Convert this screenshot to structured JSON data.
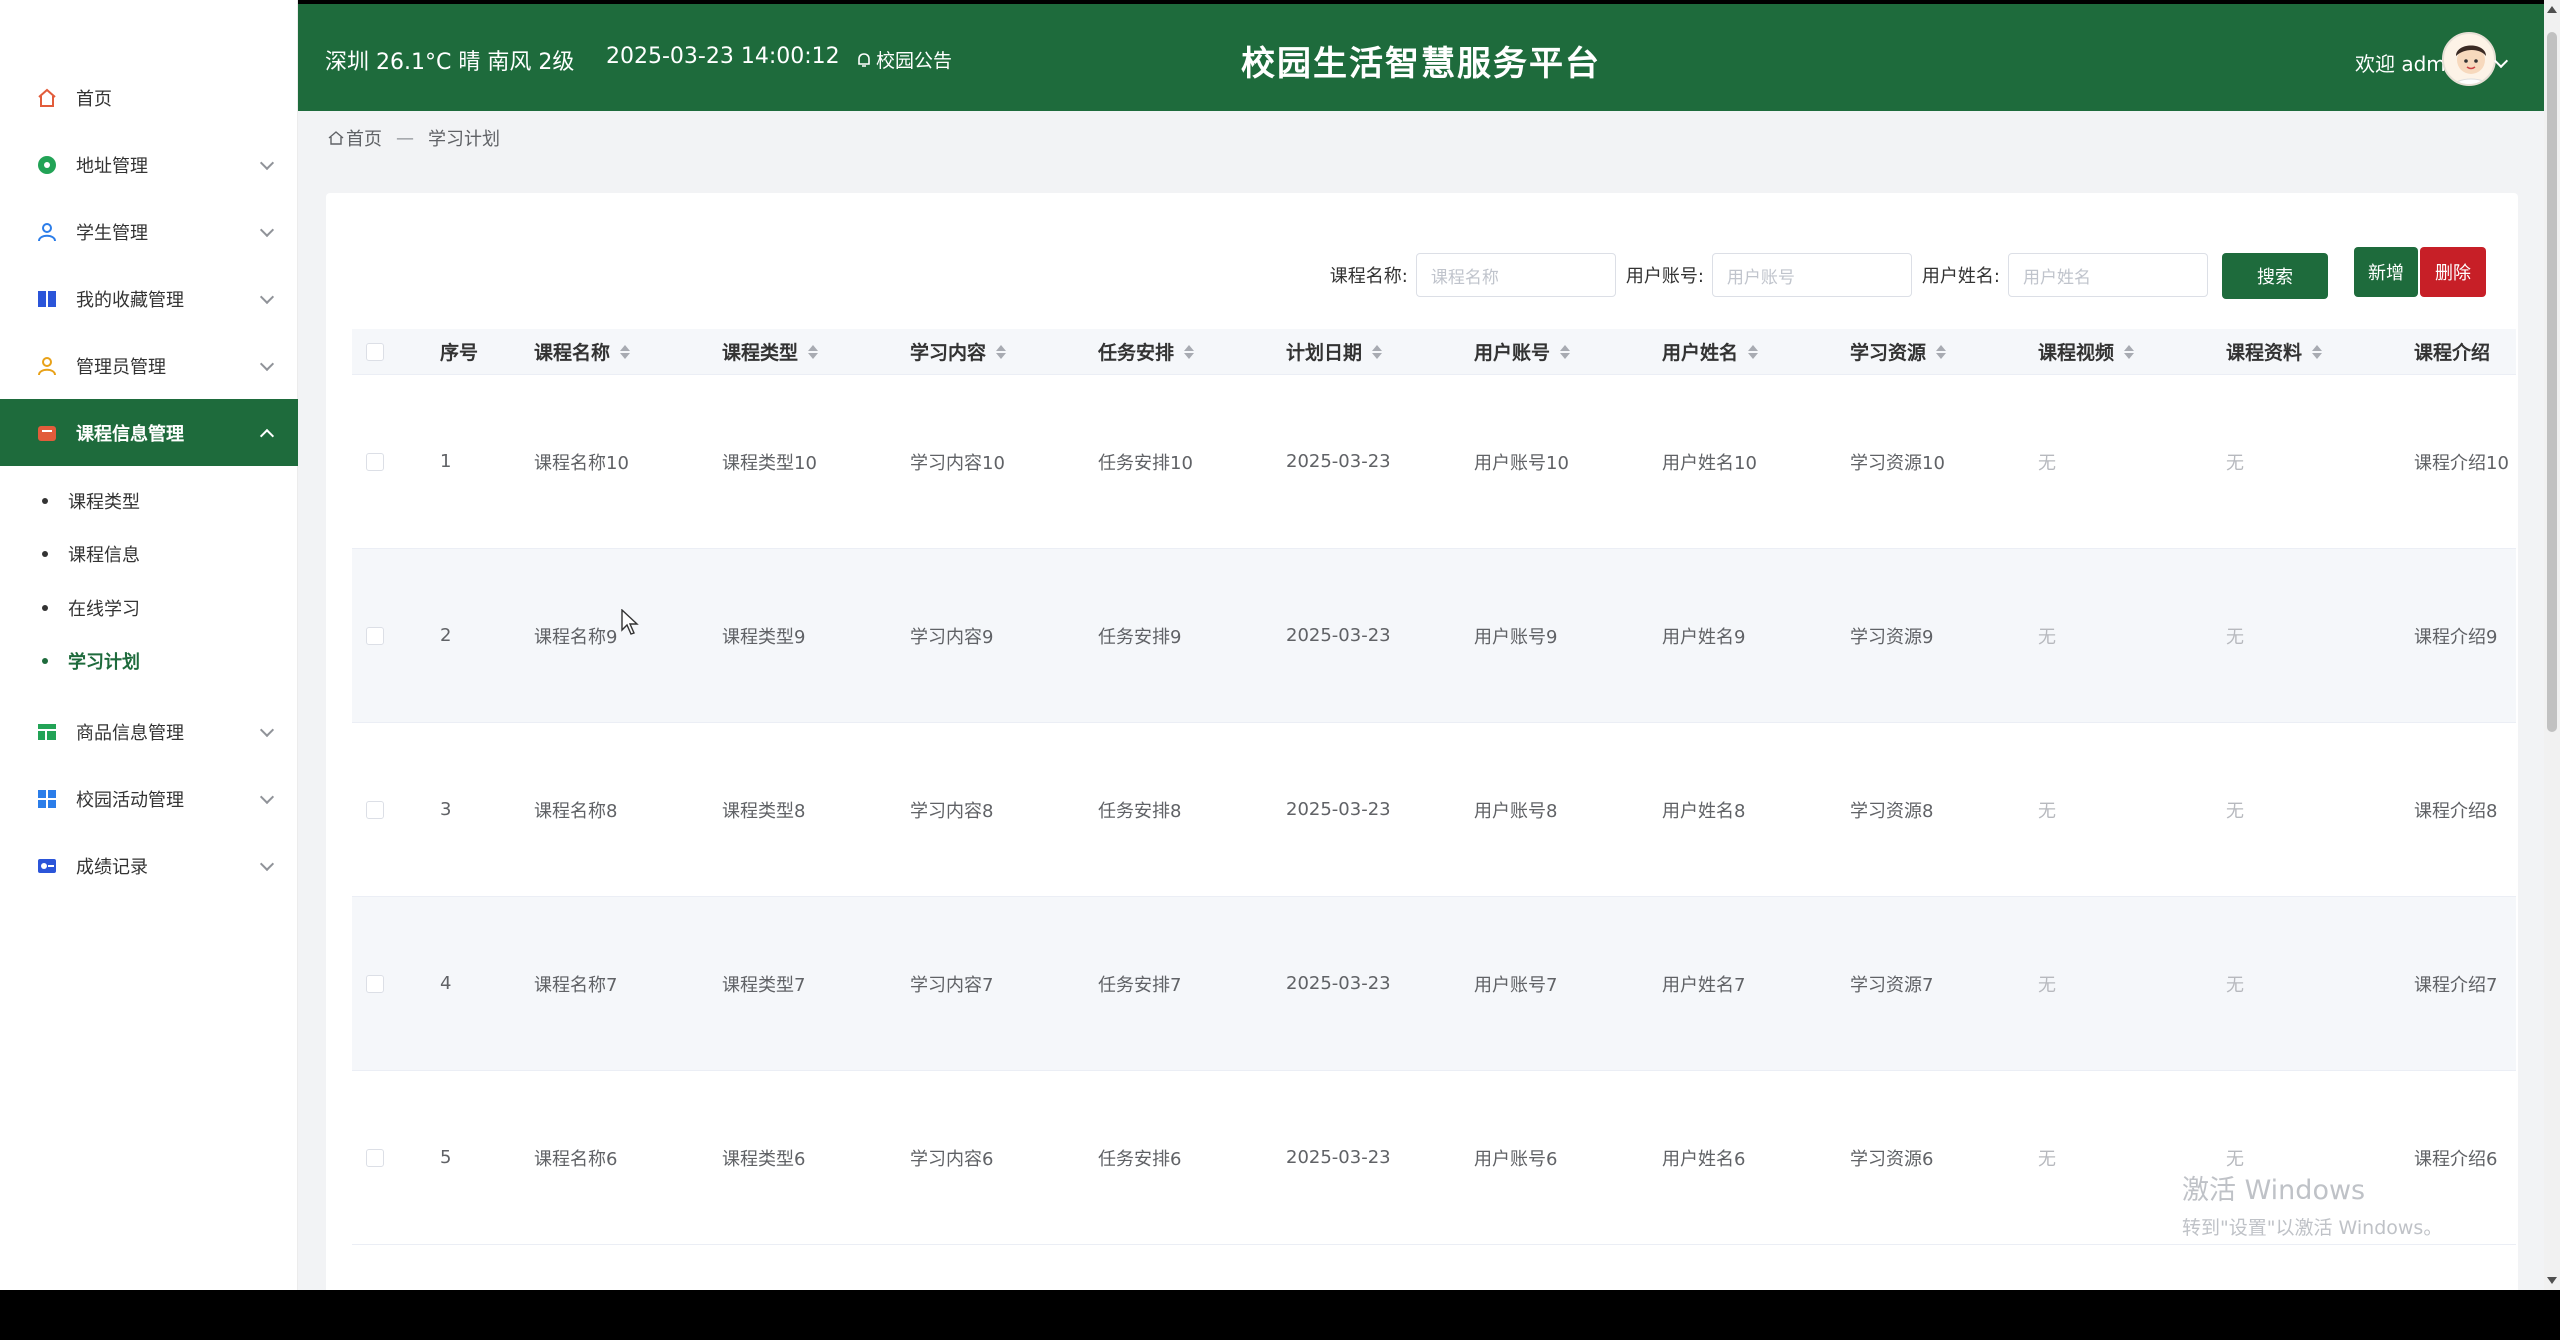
{
  "header": {
    "weather": "深圳 26.1°C 晴 南风 2级",
    "datetime": "2025-03-23 14:00:12",
    "notice": "校园公告",
    "title": "校园生活智慧服务平台",
    "welcome": "欢迎 admin"
  },
  "sidebar": {
    "items": [
      {
        "label": "首页",
        "icon": "home-icon",
        "color": "#e25c3b"
      },
      {
        "label": "地址管理",
        "icon": "location-icon",
        "color": "#22a356"
      },
      {
        "label": "学生管理",
        "icon": "user-icon",
        "color": "#2b7de9"
      },
      {
        "label": "我的收藏管理",
        "icon": "bookmark-icon",
        "color": "#2b55d9"
      },
      {
        "label": "管理员管理",
        "icon": "admin-icon",
        "color": "#e8a118"
      },
      {
        "label": "课程信息管理",
        "icon": "course-icon",
        "color": "#e25c3b"
      },
      {
        "label": "商品信息管理",
        "icon": "goods-icon",
        "color": "#22a356"
      },
      {
        "label": "校园活动管理",
        "icon": "activity-icon",
        "color": "#2b7de9"
      },
      {
        "label": "成绩记录",
        "icon": "score-icon",
        "color": "#2b55d9"
      }
    ],
    "submenu": [
      "课程类型",
      "课程信息",
      "在线学习",
      "学习计划"
    ]
  },
  "breadcrumb": {
    "home": "首页",
    "sep": "—",
    "current": "学习计划"
  },
  "search": {
    "course_label": "课程名称:",
    "course_placeholder": "课程名称",
    "account_label": "用户账号:",
    "account_placeholder": "用户账号",
    "name_label": "用户姓名:",
    "name_placeholder": "用户姓名",
    "search_btn": "搜索",
    "add_btn": "新增",
    "delete_btn": "删除"
  },
  "table": {
    "columns": [
      "序号",
      "课程名称",
      "课程类型",
      "学习内容",
      "任务安排",
      "计划日期",
      "用户账号",
      "用户姓名",
      "学习资源",
      "课程视频",
      "课程资料",
      "课程介绍"
    ],
    "rows": [
      [
        "1",
        "课程名称10",
        "课程类型10",
        "学习内容10",
        "任务安排10",
        "2025-03-23",
        "用户账号10",
        "用户姓名10",
        "学习资源10",
        "无",
        "无",
        "课程介绍10"
      ],
      [
        "2",
        "课程名称9",
        "课程类型9",
        "学习内容9",
        "任务安排9",
        "2025-03-23",
        "用户账号9",
        "用户姓名9",
        "学习资源9",
        "无",
        "无",
        "课程介绍9"
      ],
      [
        "3",
        "课程名称8",
        "课程类型8",
        "学习内容8",
        "任务安排8",
        "2025-03-23",
        "用户账号8",
        "用户姓名8",
        "学习资源8",
        "无",
        "无",
        "课程介绍8"
      ],
      [
        "4",
        "课程名称7",
        "课程类型7",
        "学习内容7",
        "任务安排7",
        "2025-03-23",
        "用户账号7",
        "用户姓名7",
        "学习资源7",
        "无",
        "无",
        "课程介绍7"
      ],
      [
        "5",
        "课程名称6",
        "课程类型6",
        "学习内容6",
        "任务安排6",
        "2025-03-23",
        "用户账号6",
        "用户姓名6",
        "学习资源6",
        "无",
        "无",
        "课程介绍6"
      ]
    ]
  },
  "watermark": {
    "line1": "激活 Windows",
    "line2": "转到\"设置\"以激活 Windows。"
  },
  "colors": {
    "primary": "#1e6b3c",
    "danger": "#c71f27"
  }
}
